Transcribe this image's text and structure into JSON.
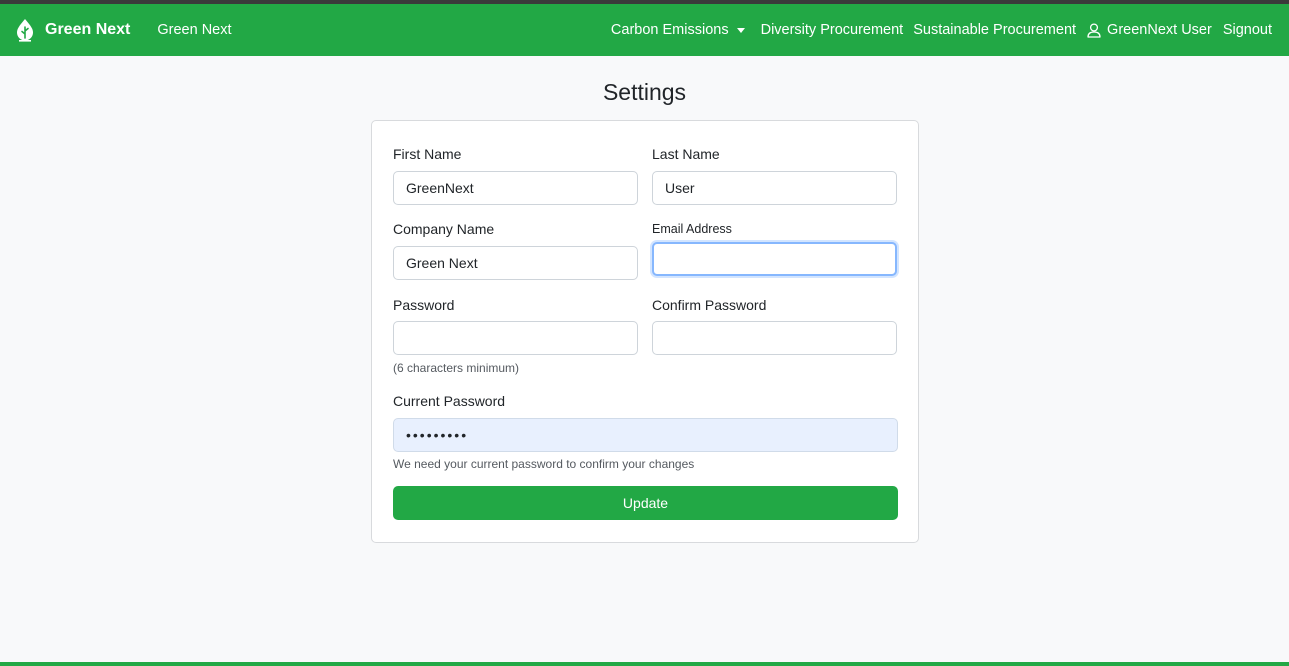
{
  "navbar": {
    "brand": "Green Next",
    "home_link": "Green Next",
    "carbon_emissions": "Carbon Emissions",
    "diversity_procurement": "Diversity Procurement",
    "sustainable_procurement": "Sustainable Procurement",
    "user_name": "GreenNext User",
    "signout": "Signout"
  },
  "colors": {
    "accent": "#22a845",
    "focus_border": "#86b7fe",
    "autofill_bg": "#e8f0fe"
  },
  "icons": [
    "leaf-logo-icon",
    "chevron-down-icon",
    "user-icon"
  ],
  "page": {
    "title": "Settings"
  },
  "form": {
    "first_name_label": "First Name",
    "first_name_value": "GreenNext",
    "last_name_label": "Last Name",
    "last_name_value": "User",
    "company_name_label": "Company Name",
    "company_name_value": "Green Next",
    "email_label": "Email Address",
    "email_value": "",
    "password_label": "Password",
    "password_value": "",
    "password_help": "(6 characters minimum)",
    "confirm_password_label": "Confirm Password",
    "confirm_password_value": "",
    "current_password_label": "Current Password",
    "current_password_value": "•••••••••",
    "current_password_help": "We need your current password to confirm your changes",
    "update_button": "Update"
  }
}
